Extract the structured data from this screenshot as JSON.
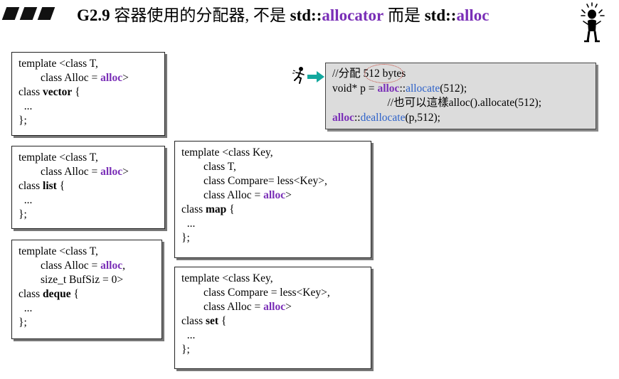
{
  "title": {
    "code": "G2.9",
    "text1": " 容器使用的分配器, 不是 ",
    "bold1": "std::",
    "kw1": "allocator",
    "text2": " 而是 ",
    "bold2": "std::",
    "kw2": "alloc"
  },
  "vector": {
    "l1": "template <class T,",
    "l2a": "        class Alloc = ",
    "kw": "alloc",
    "l2b": ">",
    "l3a": "class ",
    "name": "vector",
    "l3b": " {",
    "l4": "  ...",
    "l5": "};"
  },
  "list": {
    "l1": "template <class T,",
    "l2a": "        class Alloc = ",
    "kw": "alloc",
    "l2b": ">",
    "l3a": "class ",
    "name": "list",
    "l3b": " {",
    "l4": "  ...",
    "l5": "};"
  },
  "deque": {
    "l1": "template <class T,",
    "l2a": "        class Alloc = ",
    "kw": "alloc",
    "l2b": ",",
    "l3": "        size_t BufSiz = 0>",
    "l4a": "class ",
    "name": "deque",
    "l4b": " {",
    "l5": "  ...",
    "l6": "};"
  },
  "map": {
    "l1": "template <class Key,",
    "l2": "        class T,",
    "l3": "        class Compare= less<Key>,",
    "l4a": "        class Alloc = ",
    "kw": "alloc",
    "l4b": ">",
    "l5a": "class ",
    "name": "map",
    "l5b": " {",
    "l6": "  ...",
    "l7": "};"
  },
  "set": {
    "l1": "template <class Key,",
    "l2": "        class Compare = less<Key>,",
    "l3a": "        class Alloc = ",
    "kw": "alloc",
    "l3b": ">",
    "l4a": "class ",
    "name": "set",
    "l4b": " {",
    "l5": "  ...",
    "l6": "};"
  },
  "note": {
    "l1": "//分配 512 bytes",
    "l2a": "void* p = ",
    "l2kw": "alloc",
    "l2b": "::",
    "l2fn": "allocate",
    "l2c": "(512);",
    "l3": "                    //也可以這樣alloc().allocate(512);",
    "l4kw": "alloc",
    "l4b": "::",
    "l4fn": "deallocate",
    "l4c": "(p,512);"
  },
  "icons": [
    "slash-bars-icon",
    "runner-icon",
    "right-arrow-icon",
    "cartoon-figure-icon"
  ],
  "colors": {
    "keyword": "#7a2fb7",
    "function": "#2e62c9",
    "arrow": "#13a89e",
    "highlight": "#c0392b"
  }
}
